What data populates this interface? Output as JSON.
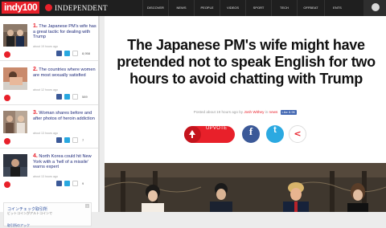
{
  "brand": {
    "logo": "indy100",
    "publisher": "INDEPENDENT",
    "accent": "#e8202a"
  },
  "nav": {
    "items": [
      "DISCOVER",
      "NEWS",
      "PEOPLE",
      "VIDEOS",
      "SPORT",
      "TECH",
      "OFFBEAT",
      "ENTS"
    ],
    "search_icon": "search-icon"
  },
  "sidebar": {
    "items": [
      {
        "num": "1.",
        "title": "The Japanese PM's wife has a great tactic for dealing with Trump",
        "meta": "about 19 hours ago",
        "count": "8,958"
      },
      {
        "num": "2.",
        "title": "The countries where women are most sexually satisfied",
        "meta": "about 12 hours ago",
        "count": "589"
      },
      {
        "num": "3.",
        "title": "Woman shares before and after photos of heroin addiction",
        "meta": "about 13 hours ago",
        "count": "7"
      },
      {
        "num": "4.",
        "title": "North Korea could hit New York with a 'hell of a missile' warns expert",
        "meta": "about 13 hours ago",
        "count": "9"
      }
    ],
    "ad": {
      "line1": "コインチェック取引所",
      "line2": "ビットコインがアルトコインで",
      "line3": "取引所のアック"
    }
  },
  "article": {
    "headline": "The Japanese PM's wife might have pretended not to speak English for two hours to avoid chatting with Trump",
    "byline_prefix": "Posted about 19 hours ago by",
    "author": "Josh Withey",
    "byline_in": "in",
    "section": "news",
    "like_label": "Like 8.9K",
    "upvote_label": "UPVOTE"
  }
}
